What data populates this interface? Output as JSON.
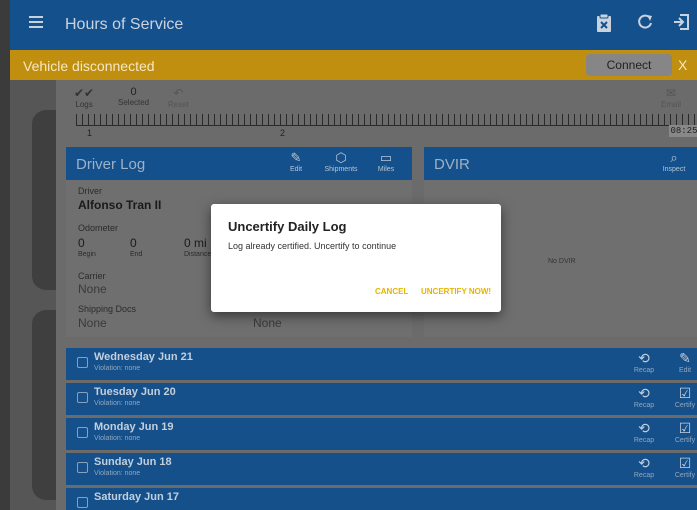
{
  "appbar": {
    "title": "Hours of Service",
    "icons": [
      "menu-icon",
      "clipboard-x-icon",
      "refresh-icon",
      "logout-icon"
    ]
  },
  "banner": {
    "message": "Vehicle disconnected",
    "connect_label": "Connect",
    "close_label": "X"
  },
  "toolbar": {
    "logs_label": "Logs",
    "selected_count": "0",
    "selected_label": "Selected",
    "reset_label": "Reset",
    "email_label": "Email",
    "ruler_start": "1",
    "ruler_mid": "2",
    "time": "08:25"
  },
  "driver_log": {
    "title": "Driver Log",
    "edit_label": "Edit",
    "shipments_label": "Shipments",
    "miles_label": "Miles",
    "driver_label": "Driver",
    "driver_name": "Alfonso Tran II",
    "odometer_label": "Odometer",
    "begin_value": "0",
    "begin_label": "Begin",
    "end_value": "0",
    "end_label": "End",
    "distance_value": "0 mi",
    "distance_label": "Distance",
    "carrier_label": "Carrier",
    "carrier_value": "None",
    "shipping_label": "Shipping Docs",
    "shipping_value": "None",
    "trailer_value": "None"
  },
  "dvir": {
    "title": "DVIR",
    "inspect_label": "Inspect",
    "empty_text": "No DVIR"
  },
  "log_days": [
    {
      "day": "Wednesday Jun 21",
      "violation": "Violation: none",
      "recap": "Recap",
      "action": "Edit"
    },
    {
      "day": "Tuesday Jun 20",
      "violation": "Violation: none",
      "recap": "Recap",
      "action": "Certify"
    },
    {
      "day": "Monday Jun 19",
      "violation": "Violation: none",
      "recap": "Recap",
      "action": "Certify"
    },
    {
      "day": "Sunday Jun 18",
      "violation": "Violation: none",
      "recap": "Recap",
      "action": "Certify"
    },
    {
      "day": "Saturday Jun 17",
      "violation": "",
      "recap": "",
      "action": ""
    }
  ],
  "dialog": {
    "title": "Uncertify Daily Log",
    "message": "Log already certified. Uncertify to continue",
    "cancel_label": "CANCEL",
    "confirm_label": "UNCERTIFY NOW!"
  },
  "colors": {
    "primary": "#14508c",
    "banner": "#c08f0f",
    "accent": "#e6b300"
  }
}
